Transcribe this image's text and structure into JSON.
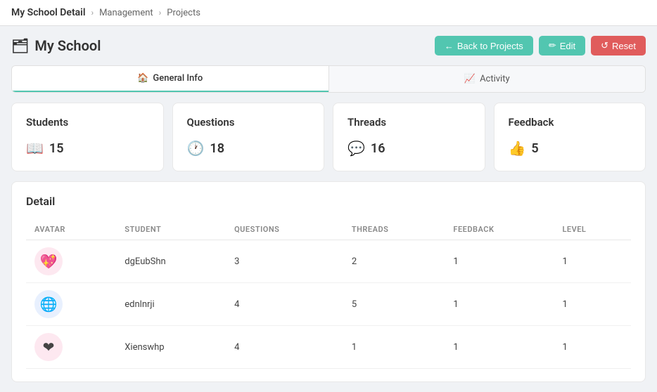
{
  "topbar": {
    "title": "My School Detail",
    "breadcrumb": [
      {
        "label": "Management"
      },
      {
        "label": "Projects"
      }
    ]
  },
  "page": {
    "title": "My School",
    "folder_icon": "🗂"
  },
  "buttons": {
    "back": "Back to Projects",
    "edit": "Edit",
    "reset": "Reset",
    "back_icon": "←",
    "edit_icon": "✏",
    "reset_icon": "↺"
  },
  "tabs": [
    {
      "label": "General Info",
      "icon": "🏠",
      "active": true
    },
    {
      "label": "Activity",
      "icon": "📈",
      "active": false
    }
  ],
  "stats": [
    {
      "title": "Students",
      "value": "15",
      "icon": "📖"
    },
    {
      "title": "Questions",
      "value": "18",
      "icon": "🕐"
    },
    {
      "title": "Threads",
      "value": "16",
      "icon": "💬"
    },
    {
      "title": "Feedback",
      "value": "5",
      "icon": "👍"
    }
  ],
  "detail": {
    "title": "Detail",
    "columns": [
      "AVATAR",
      "STUDENT",
      "QUESTIONS",
      "THREADS",
      "FEEDBACK",
      "LEVEL"
    ],
    "rows": [
      {
        "avatar": "💖",
        "avatar_class": "avatar-1",
        "student": "dgEubShn",
        "questions": "3",
        "threads": "2",
        "feedback": "1",
        "level": "1"
      },
      {
        "avatar": "🌐",
        "avatar_class": "avatar-2",
        "student": "ednlnrji",
        "questions": "4",
        "threads": "5",
        "feedback": "1",
        "level": "1"
      },
      {
        "avatar": "❤",
        "avatar_class": "avatar-3",
        "student": "Xienswhp",
        "questions": "4",
        "threads": "1",
        "feedback": "1",
        "level": "1"
      }
    ]
  }
}
